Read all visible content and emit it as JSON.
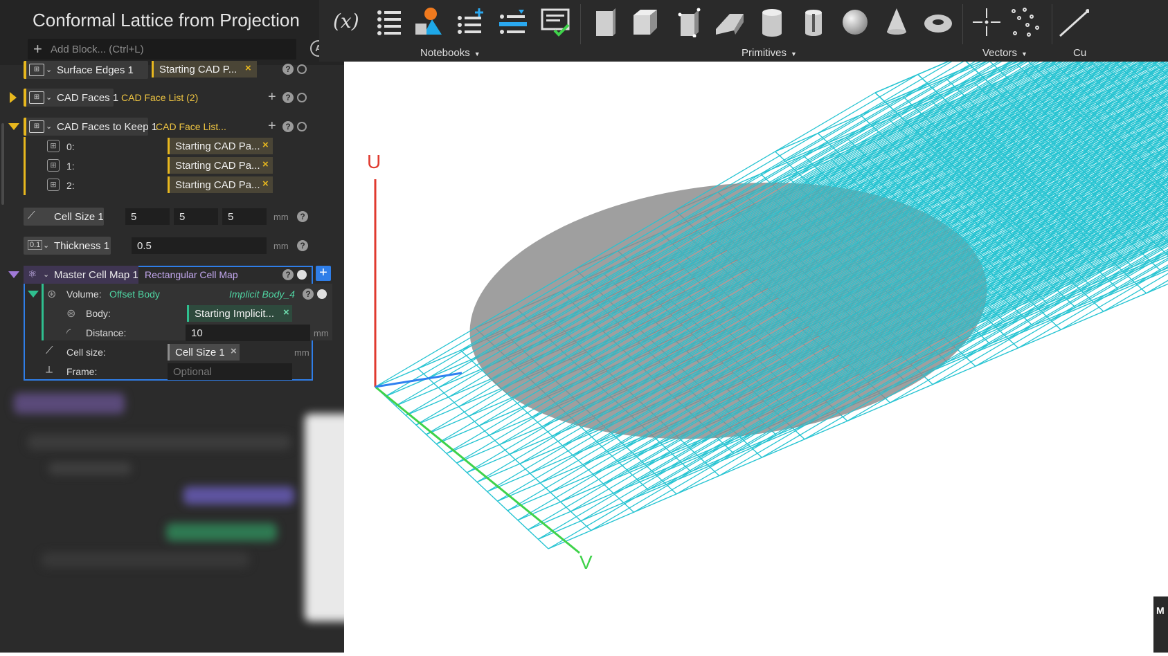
{
  "panel": {
    "title": "Conformal Lattice from Projection",
    "add_block_placeholder": "Add Block... (Ctrl+L)",
    "blocks": {
      "surface_edges": {
        "name": "Surface Edges 1",
        "ref": "Starting CAD P..."
      },
      "cad_faces": {
        "name": "CAD Faces 1",
        "value": "CAD Face List (2)"
      },
      "cad_faces_keep": {
        "name": "CAD Faces to Keep 1",
        "value": "CAD Face List...",
        "items": [
          {
            "index": "0:",
            "ref": "Starting CAD Pa..."
          },
          {
            "index": "1:",
            "ref": "Starting CAD Pa..."
          },
          {
            "index": "2:",
            "ref": "Starting CAD Pa..."
          }
        ]
      },
      "cell_size": {
        "name": "Cell Size 1",
        "x": "5",
        "y": "5",
        "z": "5",
        "unit": "mm"
      },
      "thickness": {
        "icon_text": "0.1",
        "name": "Thickness 1",
        "value": "0.5",
        "unit": "mm"
      },
      "master_cell_map": {
        "name": "Master Cell Map 1",
        "type": "Rectangular Cell Map",
        "volume_label": "Volume:",
        "volume_type": "Offset Body",
        "volume_result": "Implicit Body_4",
        "body_label": "Body:",
        "body_ref": "Starting Implicit...",
        "distance_label": "Distance:",
        "distance_value": "10",
        "distance_unit": "mm",
        "cell_size_label": "Cell size:",
        "cell_size_ref": "Cell Size 1",
        "cell_size_unit": "mm",
        "frame_label": "Frame:",
        "frame_placeholder": "Optional"
      }
    }
  },
  "toolbar": {
    "variable_icon_text": "(x)",
    "groups": [
      {
        "label": "Notebooks",
        "icons": [
          "variable-icon",
          "list-icon",
          "shapes-icon",
          "add-list-icon",
          "insert-list-icon",
          "checklist-icon"
        ]
      },
      {
        "label": "Primitives",
        "icons": [
          "box-icon",
          "cube-icon",
          "cuboid-icon",
          "wedge-icon",
          "cylinder-icon",
          "pipe-icon",
          "sphere-icon",
          "cone-icon",
          "torus-icon"
        ]
      },
      {
        "label": "Vectors",
        "icons": [
          "point-icon",
          "point-cloud-icon"
        ]
      },
      {
        "label": "Cu",
        "icons": [
          "line-icon"
        ]
      }
    ]
  },
  "viewport": {
    "axis_u": "U",
    "axis_v": "V",
    "corner_tab_text": "M",
    "colors": {
      "lattice": "#27c4d2",
      "body": "#8a8a8a",
      "axis_u": "#e03a2f",
      "axis_v": "#3fd24a",
      "axis_w": "#2f80f0"
    }
  }
}
